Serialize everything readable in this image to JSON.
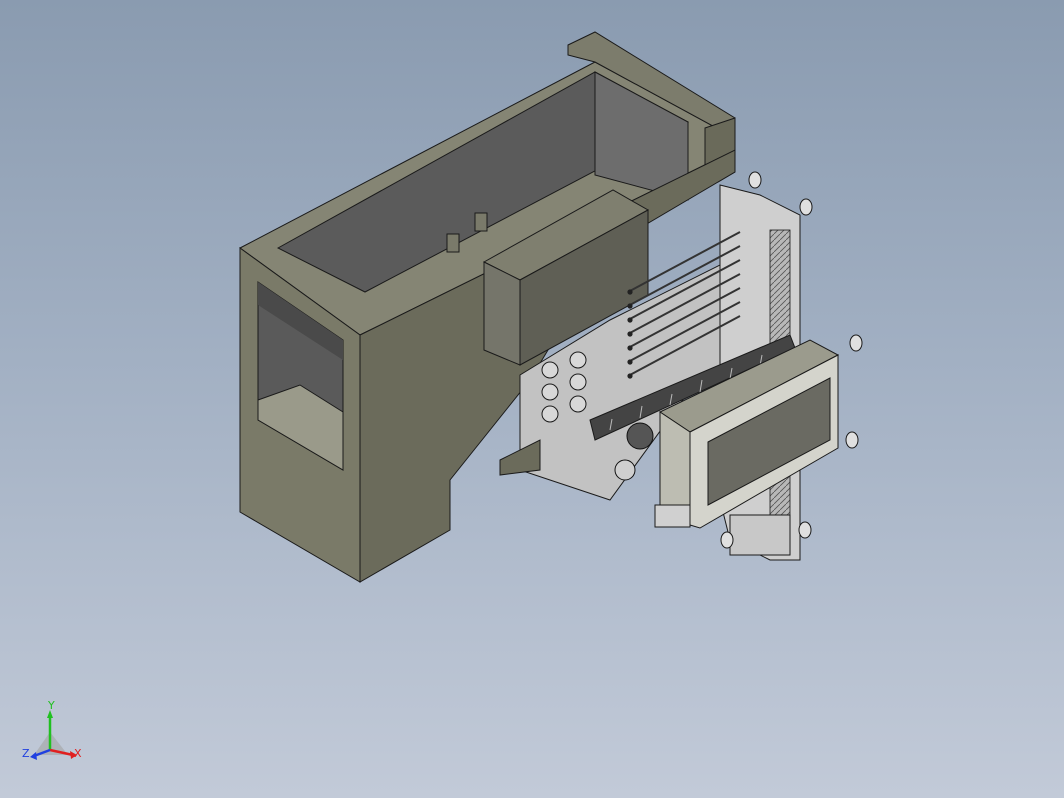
{
  "window": {
    "background_top": "#8a9bb0",
    "background_bottom": "#c2cad8"
  },
  "model": {
    "body_color": "#6e6e5e",
    "mechanism_color": "#c8c8c8",
    "edge_color": "#1a1a1a"
  },
  "triad": {
    "x_label": "X",
    "y_label": "Y",
    "z_label": "Z",
    "x_color": "#e02020",
    "y_color": "#20c020",
    "z_color": "#2040e0"
  }
}
